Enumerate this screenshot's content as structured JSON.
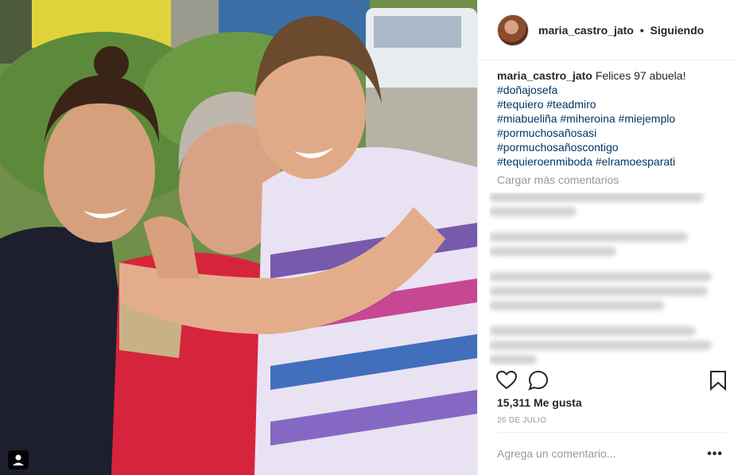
{
  "post": {
    "username": "maria_castro_jato",
    "separator": "•",
    "follow_status": "Siguiendo",
    "caption_text": "Felices 97 abuela!",
    "hashtag_line_1": "#doñajosefa",
    "hashtag_line_2": "#tequiero #teadmiro",
    "hashtag_line_3": "#miabueliña #miheroina #miejemplo",
    "hashtag_line_4": "#pormuchosañosasi",
    "hashtag_line_5": "#pormuchosañoscontigo",
    "hashtag_line_6": "#tequieroenmiboda #elramoesparati",
    "load_more": "Cargar más comentarios",
    "likes": "15,311 Me gusta",
    "date": "26 DE JULIO",
    "comment_placeholder": "Agrega un comentario...",
    "more_options": "•••"
  },
  "icons": {
    "like": "heart-icon",
    "comment": "comment-bubble-icon",
    "save": "bookmark-icon",
    "tag": "user-tag-icon",
    "more": "more-options-icon"
  },
  "colors": {
    "hashtag": "#003569",
    "muted": "#999999",
    "text": "#262626",
    "divider": "#efefef"
  }
}
